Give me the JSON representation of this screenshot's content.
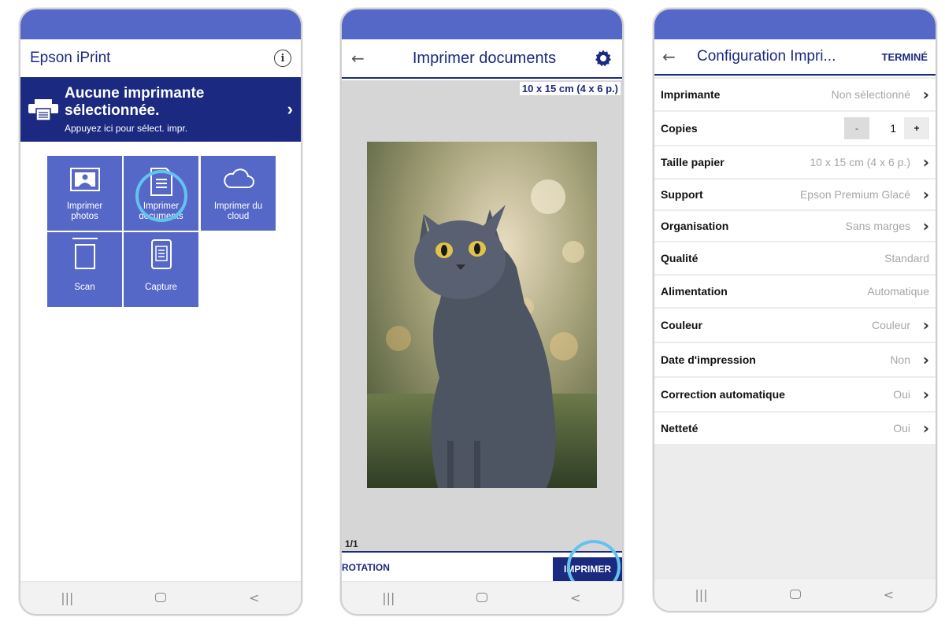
{
  "colors": {
    "accent": "#1b2a80",
    "tile": "#5568c7",
    "highlight": "#63c3ee"
  },
  "screen1": {
    "app_title": "Epson iPrint",
    "info_icon": "info-icon",
    "banner": {
      "title_line1": "Aucune imprimante",
      "title_line2": "sélectionnée.",
      "subtitle": "Appuyez ici pour sélect. impr."
    },
    "tiles": [
      {
        "line1": "Imprimer",
        "line2": "photos",
        "icon": "photo-icon"
      },
      {
        "line1": "Imprimer",
        "line2": "documents",
        "icon": "document-icon"
      },
      {
        "line1": "Imprimer du",
        "line2": "cloud",
        "icon": "cloud-icon"
      },
      {
        "line1": "Scan",
        "line2": "",
        "icon": "scanner-icon"
      },
      {
        "line1": "Capture",
        "line2": "",
        "icon": "capture-icon"
      }
    ]
  },
  "screen2": {
    "title": "Imprimer documents",
    "paper_size": "10 x 15 cm (4 x 6 p.)",
    "page_counter": "1/1",
    "rotation_label": "ROTATION",
    "print_label": "IMPRIMER"
  },
  "screen3": {
    "title": "Configuration Impri...",
    "done_label": "TERMINÉ",
    "copies": {
      "label": "Copies",
      "minus": "-",
      "value": "1",
      "plus": "+"
    },
    "rows": [
      {
        "label": "Imprimante",
        "value": "Non sélectionné",
        "chevron": true
      },
      {
        "label": "Taille papier",
        "value": "10 x 15 cm (4 x 6 p.)",
        "chevron": true
      },
      {
        "label": "Support",
        "value": "Epson Premium Glacé",
        "chevron": true
      },
      {
        "label": "Organisation",
        "value": "Sans marges",
        "chevron": true
      },
      {
        "label": "Qualité",
        "value": "Standard",
        "chevron": false
      },
      {
        "label": "Alimentation",
        "value": "Automatique",
        "chevron": false
      },
      {
        "label": "Couleur",
        "value": "Couleur",
        "chevron": true
      },
      {
        "label": "Date d'impression",
        "value": "Non",
        "chevron": true
      },
      {
        "label": "Correction automatique",
        "value": "Oui",
        "chevron": true
      },
      {
        "label": "Netteté",
        "value": "Oui",
        "chevron": true
      }
    ]
  },
  "navbar": {
    "recents": "|||",
    "back": "<"
  }
}
